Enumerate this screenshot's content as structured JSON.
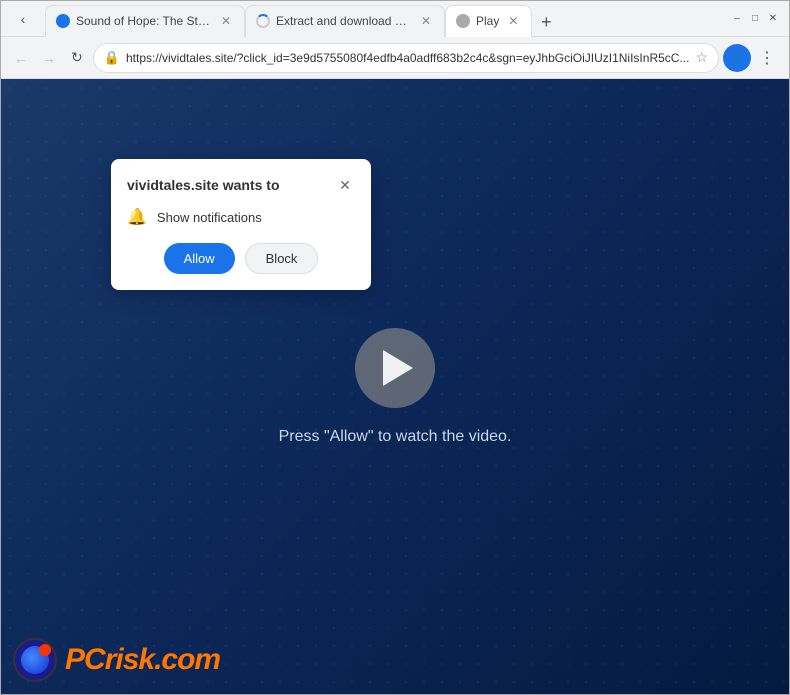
{
  "browser": {
    "tabs": [
      {
        "id": "tab1",
        "title": "Sound of Hope: The Story of...",
        "favicon": "media",
        "active": false
      },
      {
        "id": "tab2",
        "title": "Extract and download audio...",
        "favicon": "loading",
        "active": false
      },
      {
        "id": "tab3",
        "title": "Play",
        "favicon": "play",
        "active": true
      }
    ],
    "address": "https://vividtales.site/?click_id=3e9d5755080f4edfb4a0adff683b2c4c&sgn=eyJhbGciOiJIUzI1NiIsInR5cC...",
    "nav": {
      "back_disabled": true,
      "forward_disabled": true
    }
  },
  "popup": {
    "title": "vividtales.site wants to",
    "description": "Show notifications",
    "allow_label": "Allow",
    "block_label": "Block"
  },
  "page": {
    "press_text": "Press \"Allow\" to watch the video."
  },
  "pcrisk": {
    "text_gray": "PC",
    "text_orange": "risk.com"
  }
}
